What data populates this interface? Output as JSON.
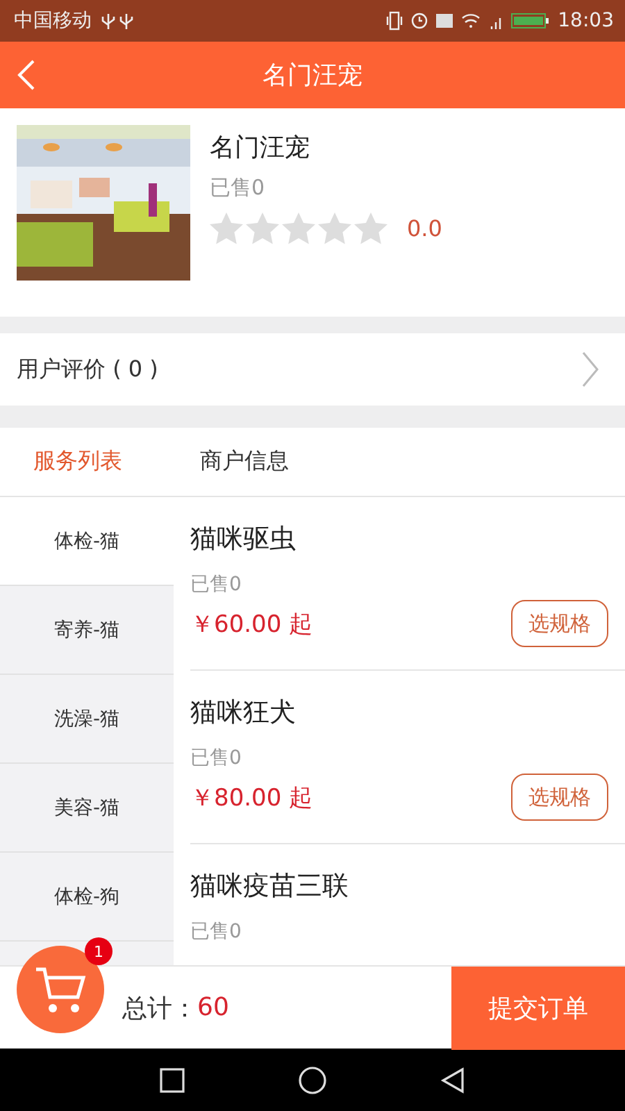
{
  "status_bar": {
    "carrier": "中国移动",
    "time": "18:03"
  },
  "header": {
    "title": "名门汪宠"
  },
  "shop": {
    "name": "名门汪宠",
    "sold": "已售0",
    "stars": 0,
    "rating": "0.0"
  },
  "reviews": {
    "label": "用户评价 ( 0 )"
  },
  "tabs": [
    {
      "label": "服务列表",
      "selected": true
    },
    {
      "label": "商户信息",
      "selected": false
    }
  ],
  "categories": [
    {
      "label": "体检-猫",
      "selected": true
    },
    {
      "label": "寄养-猫",
      "selected": false
    },
    {
      "label": "洗澡-猫",
      "selected": false
    },
    {
      "label": "美容-猫",
      "selected": false
    },
    {
      "label": "体检-狗",
      "selected": false
    }
  ],
  "products": [
    {
      "name": "猫咪驱虫",
      "sold": "已售0",
      "price": "￥60.00 起",
      "button": "选规格"
    },
    {
      "name": "猫咪狂犬",
      "sold": "已售0",
      "price": "￥80.00 起",
      "button": "选规格"
    },
    {
      "name": "猫咪疫苗三联",
      "sold": "已售0"
    }
  ],
  "cart": {
    "badge": "1",
    "total_label": "总计：",
    "total": "60",
    "submit": "提交订单"
  }
}
